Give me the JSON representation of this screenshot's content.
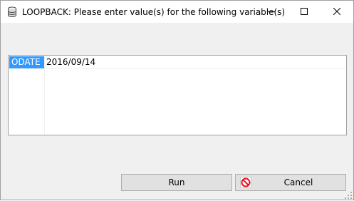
{
  "window": {
    "title": "LOOPBACK: Please enter value(s) for the following variable(s)",
    "icons": {
      "app": "database-icon",
      "minimize": "minimize-icon",
      "maximize": "maximize-icon",
      "close": "close-icon"
    }
  },
  "variables": [
    {
      "name": "ODATE",
      "value": "2016/09/14"
    }
  ],
  "buttons": {
    "run_label": "Run",
    "cancel_label": "Cancel",
    "cancel_icon": "no-entry-icon"
  },
  "colors": {
    "selection": "#3399ff",
    "window_bg": "#f0f0f0",
    "button_bg": "#e1e1e1",
    "cancel_icon": "#e81123"
  }
}
